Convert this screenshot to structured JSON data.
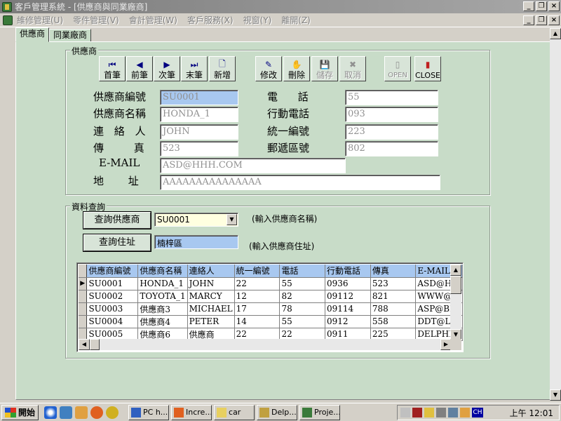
{
  "window": {
    "title": "客戶管理系統 - [供應商與同業廠商]"
  },
  "menu": [
    {
      "label": "維修管理(U)"
    },
    {
      "label": "零件管理(V)"
    },
    {
      "label": "會計管理(W)"
    },
    {
      "label": "客戶服務(X)"
    },
    {
      "label": "視窗(Y)"
    },
    {
      "label": "離開(Z)"
    }
  ],
  "tabs": [
    {
      "label": "供應商"
    },
    {
      "label": "同業廠商"
    }
  ],
  "supplier_group": {
    "label": "供應商"
  },
  "toolbar": [
    {
      "label": "首筆",
      "icon": "first-record-icon",
      "glyph": "⏮"
    },
    {
      "label": "前筆",
      "icon": "previous-record-icon",
      "glyph": "◀"
    },
    {
      "label": "次筆",
      "icon": "next-record-icon",
      "glyph": "▶"
    },
    {
      "label": "末筆",
      "icon": "last-record-icon",
      "glyph": "⏭"
    },
    {
      "label": "新增",
      "icon": "new-document-icon",
      "glyph": "🗋"
    },
    {
      "label": "修改",
      "icon": "edit-icon",
      "glyph": "✎"
    },
    {
      "label": "刪除",
      "icon": "delete-icon",
      "glyph": "✋"
    },
    {
      "label": "儲存",
      "icon": "save-icon",
      "glyph": "💾"
    },
    {
      "label": "取消",
      "icon": "cancel-icon",
      "glyph": "✖"
    },
    {
      "label": "OPEN",
      "icon": "open-icon",
      "glyph": "▯"
    },
    {
      "label": "CLOSE",
      "icon": "close-door-icon",
      "glyph": "▮"
    }
  ],
  "form": {
    "supplier_id_label": "供應商編號",
    "supplier_id": "SU0001",
    "supplier_name_label": "供應商名稱",
    "supplier_name": "HONDA_1",
    "contact_label": "連 絡 人",
    "contact": "JOHN",
    "fax_label": "傳 真",
    "fax": "523",
    "email_label": "E-MAIL",
    "email": "ASD@HHH.COM",
    "address_label": "地 址",
    "address": "AAAAAAAAAAAAAAA",
    "phone_label": "電 話",
    "phone": "55",
    "mobile_label": "行動電話",
    "mobile": "093",
    "tax_id_label": "統一編號",
    "tax_id": "223",
    "zip_label": "郵遞區號",
    "zip": "802"
  },
  "query": {
    "group_label": "資料查詢",
    "query_supplier_button": "查詢供應商",
    "supplier_combo_value": "SU0001",
    "supplier_hint": "(輸入供應商名稱)",
    "query_address_button": "查詢住址",
    "address_value": "楠梓區",
    "address_hint": "(輸入供應商住址)"
  },
  "grid": {
    "columns": [
      "供應商編號",
      "供應商名稱",
      "連絡人",
      "統一編號",
      "電話",
      "行動電話",
      "傳真",
      "E-MAIL"
    ],
    "rows": [
      [
        "SU0001",
        "HONDA_1",
        "JOHN",
        "22",
        "55",
        "0936",
        "523",
        "ASD@HH"
      ],
      [
        "SU0002",
        "TOYOTA_1",
        "MARCY",
        "12",
        "82",
        "09112",
        "821",
        "WWW@C"
      ],
      [
        "SU0003",
        "供應商3",
        "MICHAEL",
        "17",
        "78",
        "09114",
        "788",
        "ASP@BB"
      ],
      [
        "SU0004",
        "供應商4",
        "PETER",
        "14",
        "55",
        "0912",
        "558",
        "DDT@LO"
      ],
      [
        "SU0005",
        "供應商6",
        "供應商",
        "22",
        "22",
        "0911",
        "225",
        "DELPHI@"
      ]
    ]
  },
  "taskbar": {
    "start_label": "開始",
    "tasks": [
      {
        "label": "PC h..."
      },
      {
        "label": "Incre..."
      },
      {
        "label": "car"
      },
      {
        "label": "Delp..."
      },
      {
        "label": "Proje..."
      }
    ],
    "clock": "上午 12:01",
    "ime": "CH"
  }
}
